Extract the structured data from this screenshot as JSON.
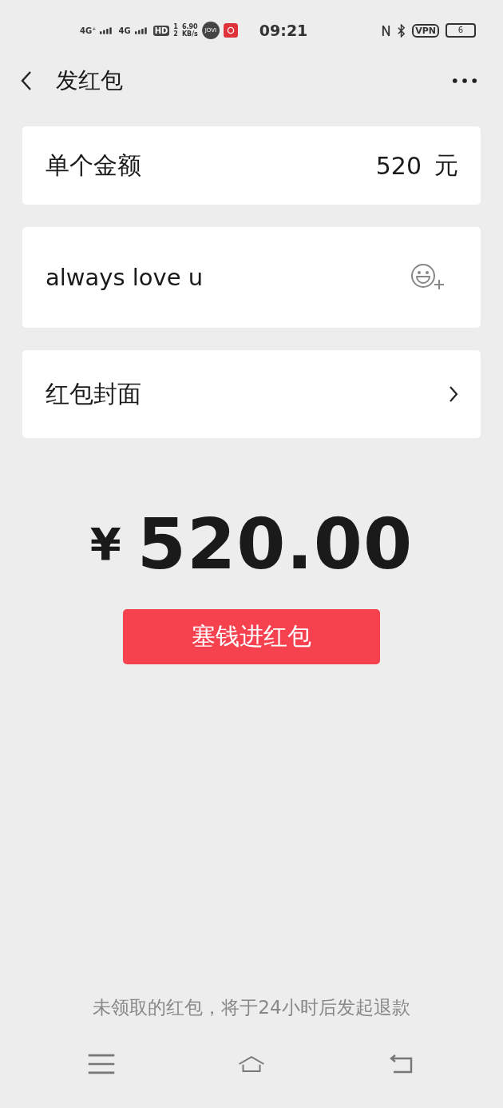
{
  "status_bar": {
    "network_1": "4G⁺",
    "network_2": "4G",
    "hd": "HD",
    "hd_sims": [
      "1",
      "2"
    ],
    "speed": "6.90",
    "speed_unit": "KB/s",
    "assistant": "JOVI",
    "time": "09:21",
    "vpn": "VPN",
    "battery": "6"
  },
  "nav": {
    "title": "发红包"
  },
  "amount_row": {
    "label": "单个金额",
    "value": "520",
    "unit": "元"
  },
  "message": {
    "value": "always love u"
  },
  "cover_row": {
    "label": "红包封面"
  },
  "total": {
    "currency": "¥",
    "amount": "520.00"
  },
  "submit_button": "塞钱进红包",
  "footer_note": "未领取的红包，将于24小时后发起退款"
}
